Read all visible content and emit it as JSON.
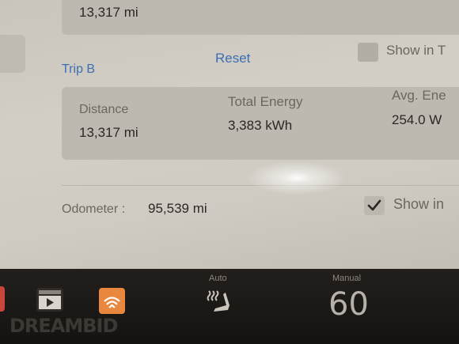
{
  "trip_a": {
    "distance_value": "13,317 mi"
  },
  "trip_b": {
    "label": "Trip B",
    "reset_label": "Reset",
    "distance_label": "Distance",
    "distance_value": "13,317 mi",
    "total_energy_label": "Total Energy",
    "total_energy_value": "3,383 kWh",
    "avg_energy_label": "Avg. Ene",
    "avg_energy_value": "254.0 W"
  },
  "show_in_top": {
    "label": "Show in T",
    "checked": false
  },
  "odometer": {
    "label": "Odometer :",
    "value": "95,539 mi"
  },
  "show_in_bottom": {
    "label": "Show in",
    "checked": true
  },
  "dock": {
    "seat_heater_mode": "Auto",
    "climate_mode": "Manual",
    "temperature": "60",
    "icons": [
      "app-red-icon",
      "video-player-icon",
      "audible-icon",
      "seat-heater-icon"
    ]
  },
  "watermark": "DREAMBID"
}
